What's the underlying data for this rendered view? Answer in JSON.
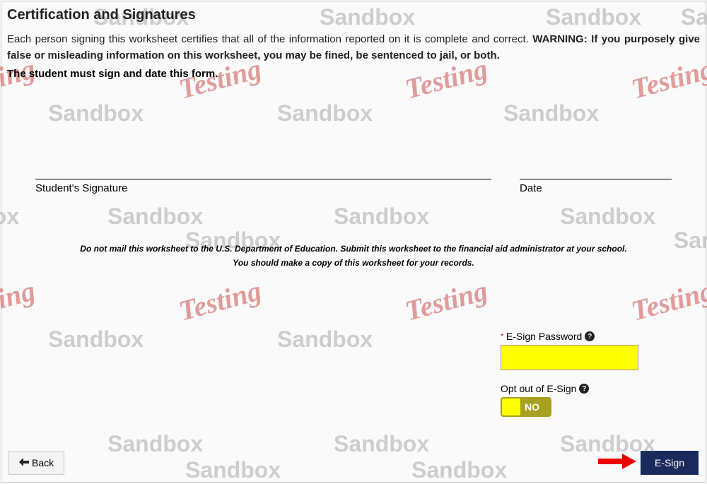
{
  "section": {
    "title": "Certification and Signatures",
    "intro_plain": "Each person signing this worksheet certifies that all of the information reported on it is complete and correct. ",
    "intro_warning": "WARNING: If you purposely give false or misleading information on this worksheet, you may be fined, be sentenced to jail, or both.",
    "must_sign": "The student must sign and date this form."
  },
  "signature": {
    "student_label": "Student's Signature",
    "date_label": "Date"
  },
  "instructions": {
    "line1": "Do not mail this worksheet to the U.S. Department of Education. Submit this worksheet to the financial aid administrator at your school.",
    "line2": "You should make a copy of this worksheet for your records."
  },
  "esign": {
    "password_label": "E-Sign Password",
    "password_value": "",
    "optout_label": "Opt out of E-Sign",
    "optout_value": "NO"
  },
  "buttons": {
    "back": "Back",
    "esign": "E-Sign"
  },
  "watermarks": {
    "sandbox": "Sandbox",
    "testing": "Testing"
  }
}
